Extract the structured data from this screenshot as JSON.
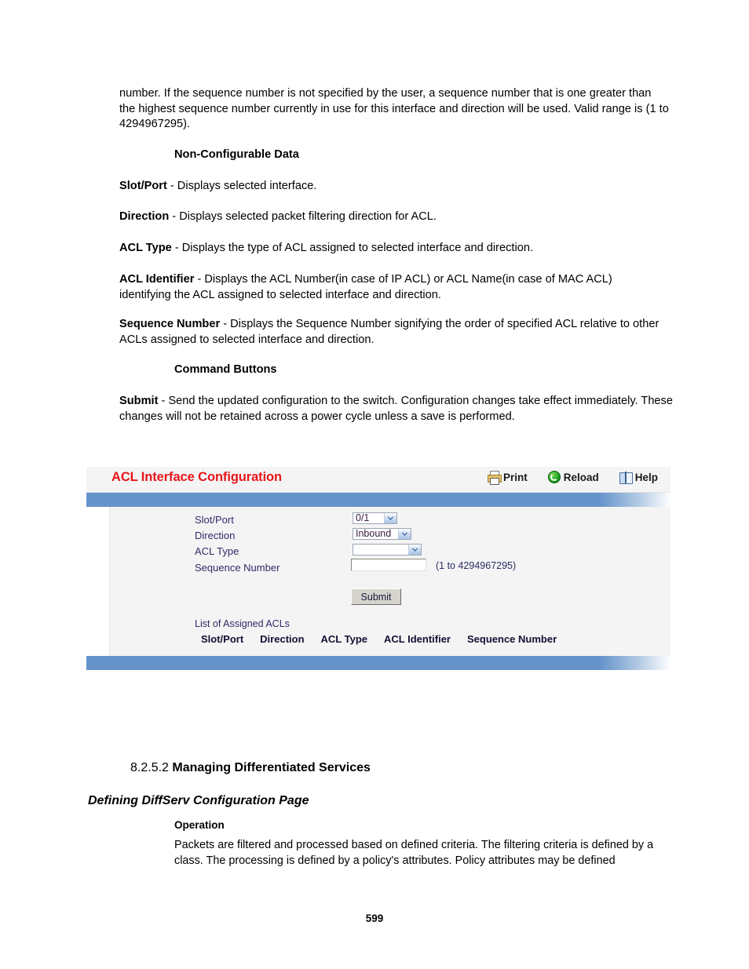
{
  "document": {
    "page_number": "599",
    "paragraphs": {
      "intro": "number. If the sequence number is not specified by the user, a sequence number that is one greater than the highest sequence number currently in use for this interface and direction will be used. Valid range is (1 to 4294967295).",
      "non_configurable_heading": "Non-Configurable Data",
      "slot_port": "Slot/Port - Displays selected interface.",
      "direction": "Direction - Displays selected packet filtering direction for ACL.",
      "acl_type": "ACL Type - Displays the type of ACL assigned to selected interface and direction.",
      "acl_identifier": "ACL Identifier - Displays the ACL Number(in case of IP ACL) or ACL Name(in case of MAC ACL) identifying the ACL assigned to selected interface and direction.",
      "sequence_number": "Sequence Number - Displays the Sequence Number signifying the order of specified ACL relative to other ACLs assigned to selected interface and direction.",
      "command_buttons_heading": "Command Buttons",
      "submit": "Submit - Send the updated configuration to the switch. Configuration changes take effect immediately. These changes will not be retained across a power cycle unless a save is performed."
    },
    "term_labels": {
      "slot_port": "Slot/Port",
      "direction": "Direction",
      "acl_type": "ACL Type",
      "acl_identifier": "ACL Identifier",
      "sequence_number": "Sequence Number",
      "submit": "Submit"
    },
    "section": {
      "number": "8.2.5.2 ",
      "title": "Managing Differentiated Services",
      "subtitle": "Defining DiffServ Configuration Page",
      "operation_heading": "Operation",
      "operation_text": "Packets are filtered and processed based on defined criteria. The filtering criteria is defined by a class. The processing is defined by a policy's attributes. Policy attributes may be defined"
    }
  },
  "panel": {
    "title": "ACL Interface Configuration",
    "title_color": "#e8161a",
    "accent_bar_color": "#6694ca",
    "actions": [
      {
        "label": "Print",
        "icon": "printer-icon"
      },
      {
        "label": "Reload",
        "icon": "reload-icon"
      },
      {
        "label": "Help",
        "icon": "help-book-icon"
      }
    ],
    "form": {
      "fields": [
        {
          "label": "Slot/Port",
          "value": "0/1",
          "control": "select"
        },
        {
          "label": "Direction",
          "value": "Inbound",
          "control": "select"
        },
        {
          "label": "ACL Type",
          "value": "",
          "control": "select"
        },
        {
          "label": "Sequence Number",
          "value": "",
          "control": "text",
          "placeholder": "",
          "hint": "(1 to 4294967295)"
        }
      ],
      "submit_label": "Submit"
    },
    "list": {
      "caption": "List of Assigned ACLs",
      "columns": [
        "Slot/Port",
        "Direction",
        "ACL Type",
        "ACL Identifier",
        "Sequence Number"
      ],
      "rows": []
    }
  }
}
